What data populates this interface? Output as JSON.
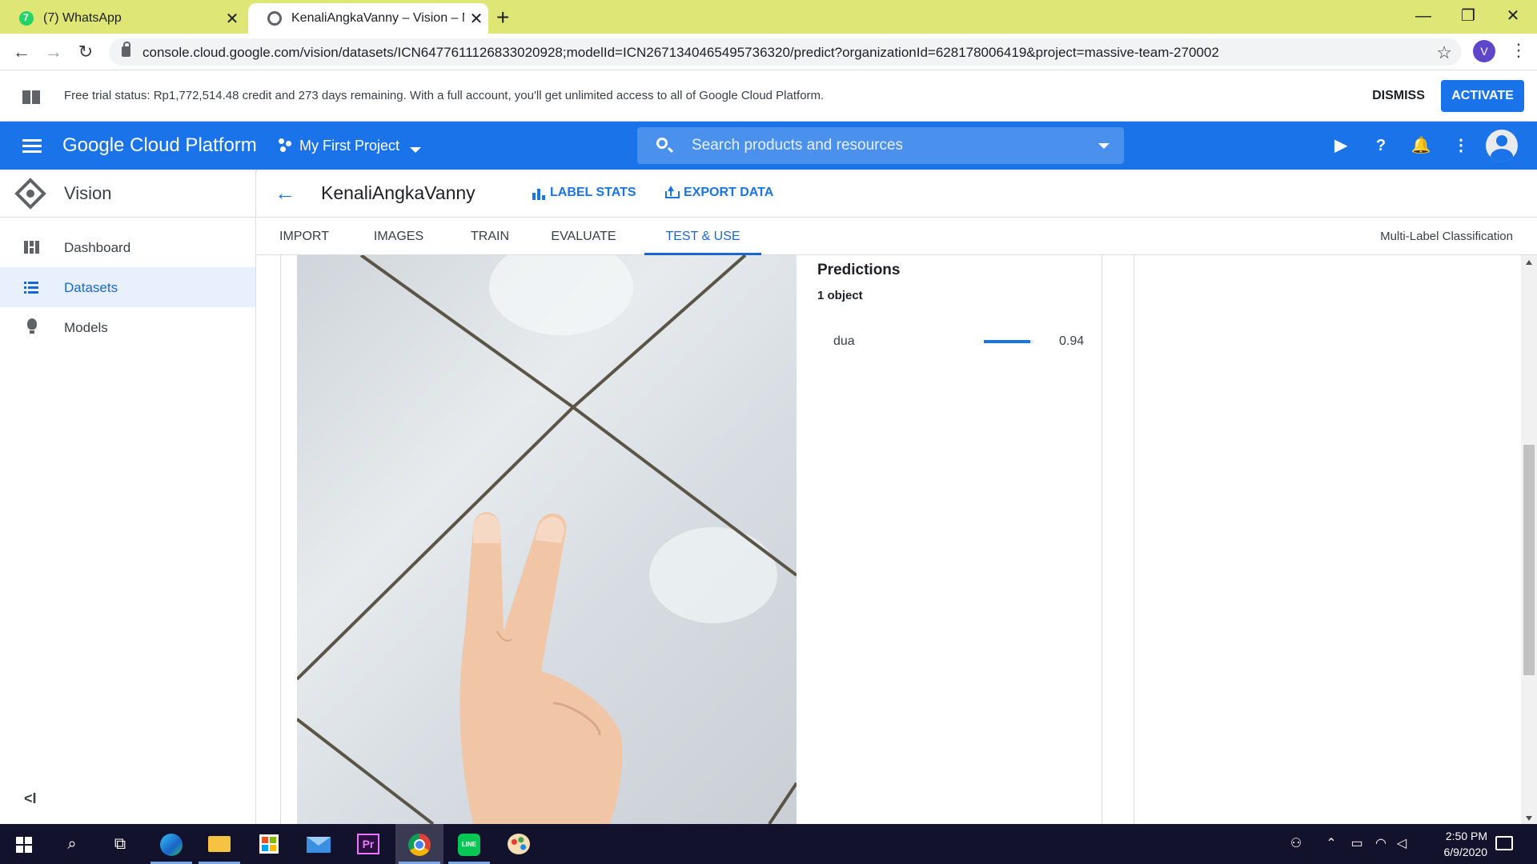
{
  "browser": {
    "tabs": [
      {
        "title": "(7) WhatsApp",
        "close": "✕"
      },
      {
        "title": "KenaliAngkaVanny – Vision – My",
        "close": "✕"
      }
    ],
    "new_tab": "+",
    "url": "console.cloud.google.com/vision/datasets/ICN6477611126833020928;modelId=ICN2671340465495736320/predict?organizationId=628178006419&project=massive-team-270002",
    "profile_initial": "V",
    "window_controls": {
      "minimize": "—",
      "restore": "❐",
      "close": "✕"
    }
  },
  "banner": {
    "text": "Free trial status: Rp1,772,514.48 credit and 273 days remaining. With a full account, you'll get unlimited access to all of Google Cloud Platform.",
    "dismiss": "DISMISS",
    "activate": "ACTIVATE"
  },
  "header": {
    "title": "Google Cloud Platform",
    "project": "My First Project",
    "search_placeholder": "Search products and resources"
  },
  "sidebar": {
    "product": "Vision",
    "items": [
      {
        "label": "Dashboard",
        "active": false
      },
      {
        "label": "Datasets",
        "active": true
      },
      {
        "label": "Models",
        "active": false
      }
    ],
    "collapse": "<I"
  },
  "page": {
    "dataset_title": "KenaliAngkaVanny",
    "actions": {
      "label_stats": "LABEL STATS",
      "export_data": "EXPORT DATA"
    },
    "tabs": [
      {
        "label": "IMPORT",
        "active": false
      },
      {
        "label": "IMAGES",
        "active": false
      },
      {
        "label": "TRAIN",
        "active": false
      },
      {
        "label": "EVALUATE",
        "active": false
      },
      {
        "label": "TEST & USE",
        "active": true
      }
    ],
    "classification_type": "Multi-Label Classification"
  },
  "predictions": {
    "title": "Predictions",
    "count": "1 object",
    "items": [
      {
        "label": "dua",
        "score": 0.94,
        "score_text": "0.94"
      }
    ]
  },
  "taskbar": {
    "time": "2:50 PM",
    "date": "6/9/2020",
    "pr_label": "Pr",
    "line_label": "LINE"
  },
  "colors": {
    "accent": "#1a73e8",
    "tabstrip": "#dee675",
    "taskbar": "#13122c"
  }
}
